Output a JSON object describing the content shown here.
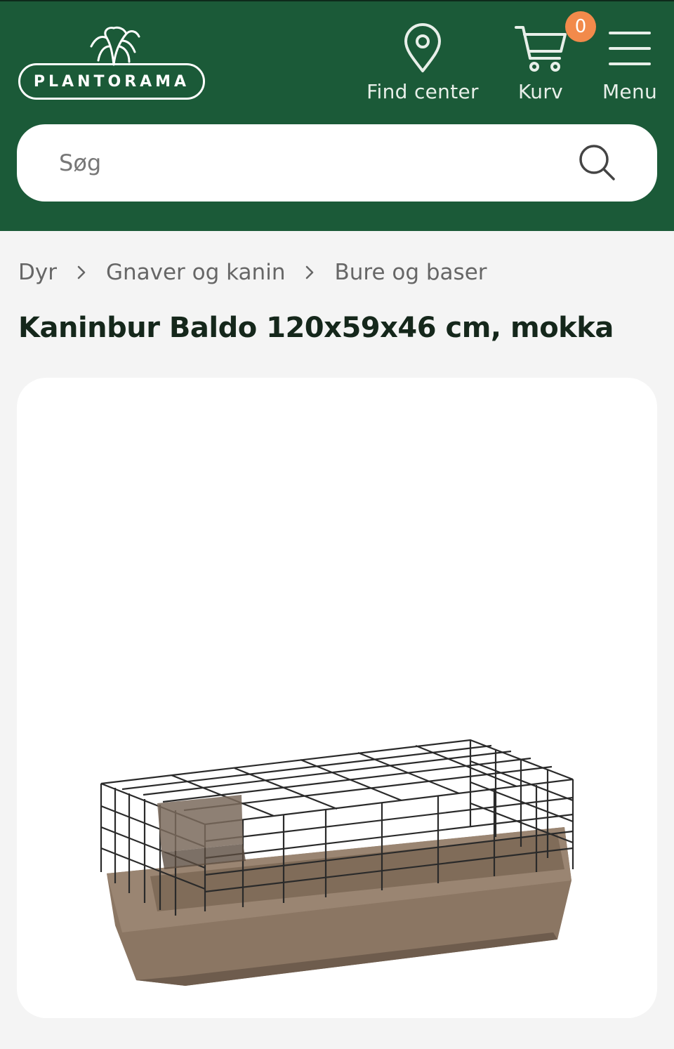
{
  "header": {
    "logo_text": "PLANTORAMA",
    "find_center_label": "Find center",
    "cart_label": "Kurv",
    "cart_count": "0",
    "menu_label": "Menu"
  },
  "search": {
    "placeholder": "Søg"
  },
  "breadcrumb": {
    "items": [
      "Dyr",
      "Gnaver og kanin",
      "Bure og baser"
    ]
  },
  "product": {
    "title": "Kaninbur Baldo 120x59x46 cm, mokka"
  },
  "colors": {
    "header_bg": "#1b5a38",
    "badge": "#f28a4b",
    "page_bg": "#f4f4f4"
  }
}
